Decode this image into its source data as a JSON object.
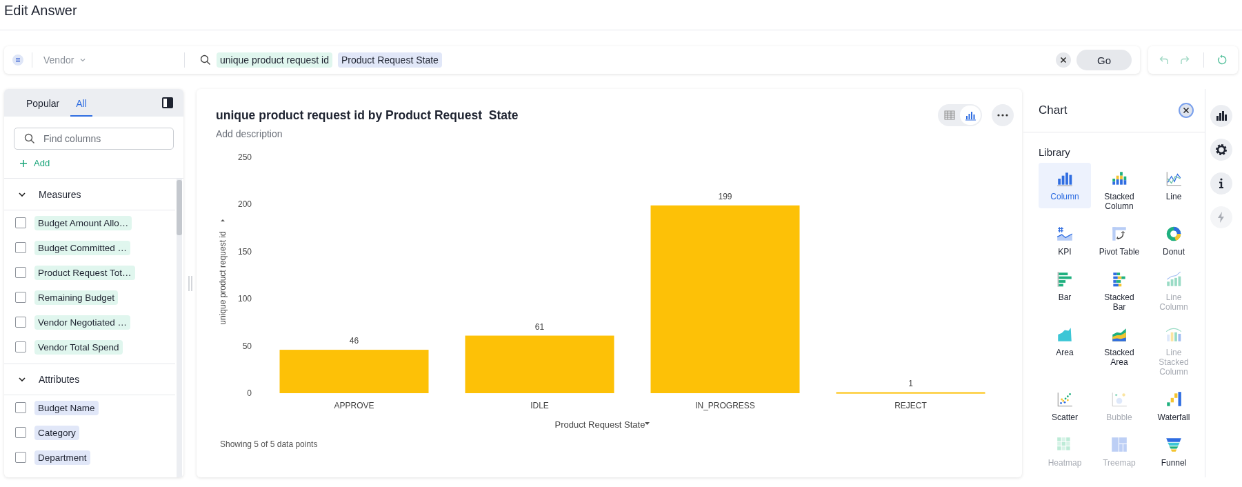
{
  "header": {
    "title": "Edit Answer"
  },
  "search_bar": {
    "source": "Vendor",
    "tokens": [
      {
        "text": "unique product request id",
        "kind": "measure"
      },
      {
        "text": "Product Request  State",
        "kind": "attribute"
      }
    ],
    "go_button": "Go"
  },
  "column_panel": {
    "tabs": [
      {
        "label": "Popular",
        "selected": false
      },
      {
        "label": "All",
        "selected": true
      }
    ],
    "search": {
      "placeholder": "Find columns"
    },
    "add_link": "Add",
    "sections": [
      {
        "title": "Measures",
        "kind": "measure",
        "expanded": true,
        "items": [
          {
            "label": "Budget Amount Allo…",
            "checked": false
          },
          {
            "label": "Budget Committed …",
            "checked": false
          },
          {
            "label": "Product Request Tot…",
            "checked": false
          },
          {
            "label": "Remaining Budget",
            "checked": false
          },
          {
            "label": "Vendor Negotiated …",
            "checked": false
          },
          {
            "label": "Vendor Total Spend",
            "checked": false
          }
        ]
      },
      {
        "title": "Attributes",
        "kind": "attribute",
        "expanded": true,
        "items": [
          {
            "label": "Budget Name",
            "checked": false
          },
          {
            "label": "Category",
            "checked": false
          },
          {
            "label": "Department",
            "checked": false
          }
        ]
      }
    ]
  },
  "answer": {
    "title": "unique product request id by Product Request  State",
    "description_placeholder": "Add description",
    "view_toggle": [
      {
        "kind": "table",
        "selected": false
      },
      {
        "kind": "chart",
        "selected": true
      }
    ],
    "chart_data": {
      "type": "bar",
      "xlabel": "Product Request State",
      "ylabel": "unique product request id",
      "categories": [
        "APPROVE",
        "IDLE",
        "IN_PROGRESS",
        "REJECT"
      ],
      "series": [
        {
          "color": "#fdc107",
          "values": [
            46,
            61,
            199,
            1
          ]
        }
      ],
      "ylim": [
        0,
        250
      ],
      "yticks": [
        0,
        50,
        100,
        150,
        200,
        250
      ],
      "data_labels": true
    },
    "footer": "Showing 5 of 5 data points"
  },
  "chart_panel": {
    "title": "Chart",
    "library_title": "Library",
    "types": [
      {
        "label": "Column",
        "kind": "column",
        "selected": true,
        "disabled": false
      },
      {
        "label": "Stacked Column",
        "kind": "stacked-column",
        "selected": false,
        "disabled": false
      },
      {
        "label": "Line",
        "kind": "line",
        "selected": false,
        "disabled": false
      },
      {
        "label": "KPI",
        "kind": "kpi",
        "selected": false,
        "disabled": false
      },
      {
        "label": "Pivot Table",
        "kind": "pivot",
        "selected": false,
        "disabled": false
      },
      {
        "label": "Donut",
        "kind": "donut",
        "selected": false,
        "disabled": false
      },
      {
        "label": "Bar",
        "kind": "bar",
        "selected": false,
        "disabled": false
      },
      {
        "label": "Stacked Bar",
        "kind": "stacked-bar",
        "selected": false,
        "disabled": false
      },
      {
        "label": "Line Column",
        "kind": "line-column",
        "selected": false,
        "disabled": true
      },
      {
        "label": "Area",
        "kind": "area",
        "selected": false,
        "disabled": false
      },
      {
        "label": "Stacked Area",
        "kind": "stacked-area",
        "selected": false,
        "disabled": false
      },
      {
        "label": "Line Stacked Column",
        "kind": "line-stacked-column",
        "selected": false,
        "disabled": true
      },
      {
        "label": "Scatter",
        "kind": "scatter",
        "selected": false,
        "disabled": false
      },
      {
        "label": "Bubble",
        "kind": "bubble",
        "selected": false,
        "disabled": true
      },
      {
        "label": "Waterfall",
        "kind": "waterfall",
        "selected": false,
        "disabled": false
      },
      {
        "label": "Heatmap",
        "kind": "heatmap",
        "selected": false,
        "disabled": true
      },
      {
        "label": "Treemap",
        "kind": "treemap",
        "selected": false,
        "disabled": true
      },
      {
        "label": "Funnel",
        "kind": "funnel",
        "selected": false,
        "disabled": false
      }
    ]
  },
  "side_rail": [
    {
      "kind": "chart",
      "disabled": false
    },
    {
      "kind": "settings",
      "disabled": false
    },
    {
      "kind": "info",
      "disabled": false
    },
    {
      "kind": "lightning",
      "disabled": true
    }
  ]
}
